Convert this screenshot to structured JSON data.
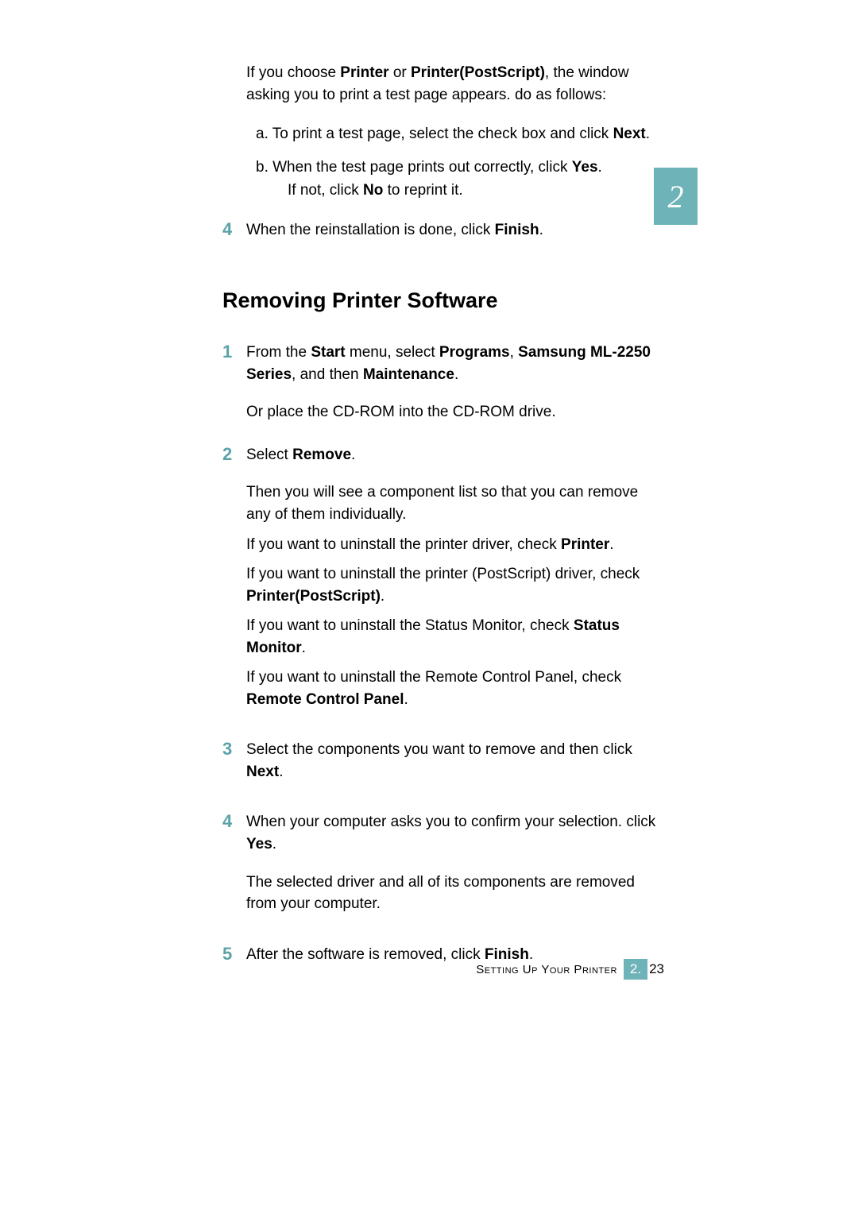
{
  "chapter_number": "2",
  "intro": {
    "prefix": "If you choose ",
    "b1": "Printer",
    "mid": " or ",
    "b2": "Printer(PostScript)",
    "suffix": ", the window asking you to print a test page appears. do as follows:"
  },
  "sub_a": {
    "prefix": "a. To print a test page, select the check box and click ",
    "bold": "Next",
    "suffix": "."
  },
  "sub_b": {
    "line1_prefix": "b. When the test page prints out correctly, click ",
    "line1_bold": "Yes",
    "line1_suffix": ".",
    "line2_prefix": "If not, click ",
    "line2_bold": "No",
    "line2_suffix": " to reprint it."
  },
  "step4_top": {
    "num": "4",
    "prefix": "When the reinstallation is done, click ",
    "bold": "Finish",
    "suffix": "."
  },
  "heading": "Removing Printer Software",
  "step1": {
    "num": "1",
    "t1": "From the ",
    "b1": "Start",
    "t2": " menu, select ",
    "b2": "Programs",
    "t3": ", ",
    "b3": "Samsung ML-2250 Series",
    "t4": ", and then ",
    "b4": "Maintenance",
    "t5": ".",
    "para2": "Or place the CD-ROM into the CD-ROM drive."
  },
  "step2": {
    "num": "2",
    "t1": "Select ",
    "b1": "Remove",
    "t2": ".",
    "para2": "Then you will see a component list so that you can remove any of them individually.",
    "para3_t1": "If you want to uninstall the printer driver, check ",
    "para3_b1": "Printer",
    "para3_t2": ".",
    "para4_t1": "If you want to uninstall the printer (PostScript) driver, check ",
    "para4_b1": "Printer(PostScript)",
    "para4_t2": ".",
    "para5_t1": "If you want to uninstall the Status Monitor, check ",
    "para5_b1": "Status Monitor",
    "para5_t2": ".",
    "para6_t1": "If you want to uninstall the Remote Control Panel, check ",
    "para6_b1": "Remote Control Panel",
    "para6_t2": "."
  },
  "step3": {
    "num": "3",
    "t1": "Select the components you want to remove and then click ",
    "b1": "Next",
    "t2": "."
  },
  "step4": {
    "num": "4",
    "t1": "When your computer asks you to confirm your selection. click ",
    "b1": "Yes",
    "t2": ".",
    "para2": "The selected driver and all of its components are removed from your computer."
  },
  "step5": {
    "num": "5",
    "t1": "After the software is removed, click ",
    "b1": "Finish",
    "t2": "."
  },
  "footer": {
    "text": "Setting Up Your Printer",
    "chapter": "2.",
    "page": "23"
  }
}
